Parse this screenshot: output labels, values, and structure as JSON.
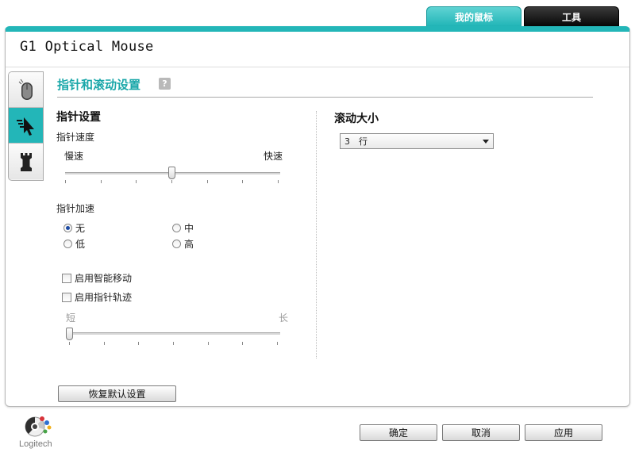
{
  "tabs": {
    "my_mouse": "我的鼠标",
    "tools": "工具"
  },
  "device_title": "G1 Optical Mouse",
  "section_title": "指针和滚动设置",
  "help": "?",
  "pointer": {
    "heading": "指针设置",
    "speed_label": "指针速度",
    "slow": "慢速",
    "fast": "快速",
    "speed_value_fraction": 0.5,
    "accel_label": "指针加速",
    "accel_options": {
      "none": "无",
      "medium": "中",
      "low": "低",
      "high": "高"
    },
    "accel_selected": "无",
    "smart_move": "启用智能移动",
    "trails": "启用指针轨迹",
    "short": "短",
    "long": "长",
    "trail_value_fraction": 0
  },
  "scroll": {
    "heading": "滚动大小",
    "selected": "3　行"
  },
  "buttons": {
    "restore": "恢复默认设置",
    "ok": "确定",
    "cancel": "取消",
    "apply": "应用"
  },
  "logo_text": "Logitech",
  "colors": {
    "accent": "#23b6b8",
    "tools_tab": "#111111"
  }
}
